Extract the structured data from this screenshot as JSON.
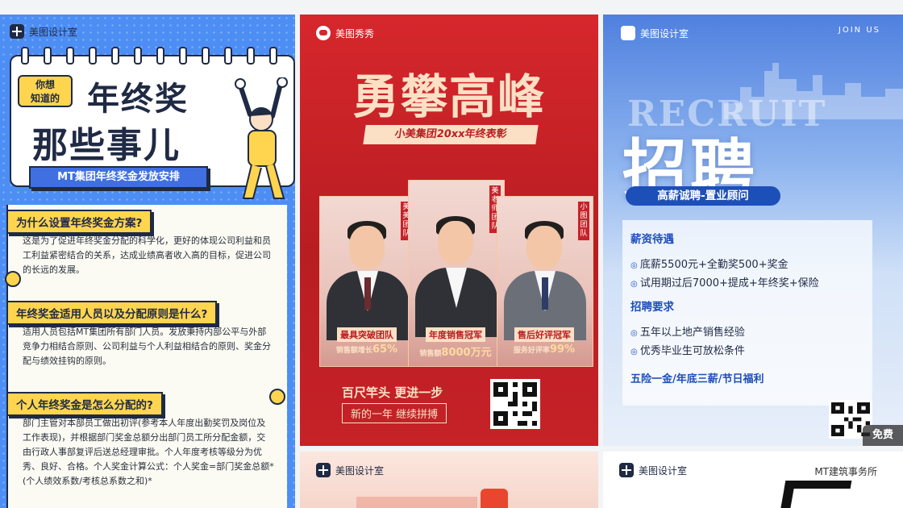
{
  "card1": {
    "brand": "美图设计室",
    "prefix_line1": "你想",
    "prefix_line2": "知道的",
    "title_line1": "年终奖",
    "title_line2": "那些事儿",
    "subtitle": "MT集团年终奖金发放安排",
    "sections": [
      {
        "q": "为什么设置年终奖金方案?",
        "a": "这是为了促进年终奖金分配的科学化，更好的体现公司利益和员工利益紧密结合的关系，达成业绩高者收入高的目标，促进公司的长远的发展。"
      },
      {
        "q": "年终奖金适用人员以及分配原则是什么?",
        "a": "适用人员包括MT集团所有部门人员。发放秉持内部公平与外部竞争力相结合原则、公司利益与个人利益相结合的原则、奖金分配与绩效挂钩的原则。"
      },
      {
        "q": "个人年终奖金是怎么分配的?",
        "a": "部门主管对本部员工做出初评(参考本人年度出勤奖罚及岗位及工作表现)，并根据部门奖金总额分出部门员工所分配金额，交由行政人事部复评后送总经理审批。个人年度考核等级分为优秀、良好、合格。个人奖金计算公式：个人奖金=部门奖金总额*(个人绩效系数/考核总系数之和)*"
      }
    ]
  },
  "card2": {
    "brand": "美图秀秀",
    "title": "勇攀高峰",
    "ribbon": "小美集团20xx年终表彰",
    "people": [
      {
        "tag": "美美团队",
        "award": "最具突破团队",
        "stat_label": "销售额增长",
        "stat_value": "65%"
      },
      {
        "tag": "美老师团队",
        "award": "年度销售冠军",
        "stat_label": "销售额",
        "stat_value": "8000万元"
      },
      {
        "tag": "小图团队",
        "award": "售后好评冠军",
        "stat_label": "服务好评率",
        "stat_value": "99%"
      }
    ],
    "slogan1": "百尺竿头 更进一步",
    "slogan2": "新的一年 继续拼搏"
  },
  "card3": {
    "brand": "美图设计室",
    "join": "JOIN US",
    "recruit_en": "RECRUIT",
    "title": "招聘",
    "pill": "高薪诚聘-置业顾问",
    "salary_title": "薪资待遇",
    "salary_items": [
      "底薪5500元+全勤奖500+奖金",
      "试用期过后7000+提成+年终奖+保险"
    ],
    "req_title": "招聘要求",
    "req_items": [
      "五年以上地产销售经验",
      "优秀毕业生可放松条件"
    ],
    "welfare": "五险一金/年底三薪/节日福利",
    "badge": "免费"
  },
  "card4": {
    "brand": "美图设计室"
  },
  "card5": {
    "brand": "美图设计室",
    "right_text": "MT建筑事务所"
  }
}
